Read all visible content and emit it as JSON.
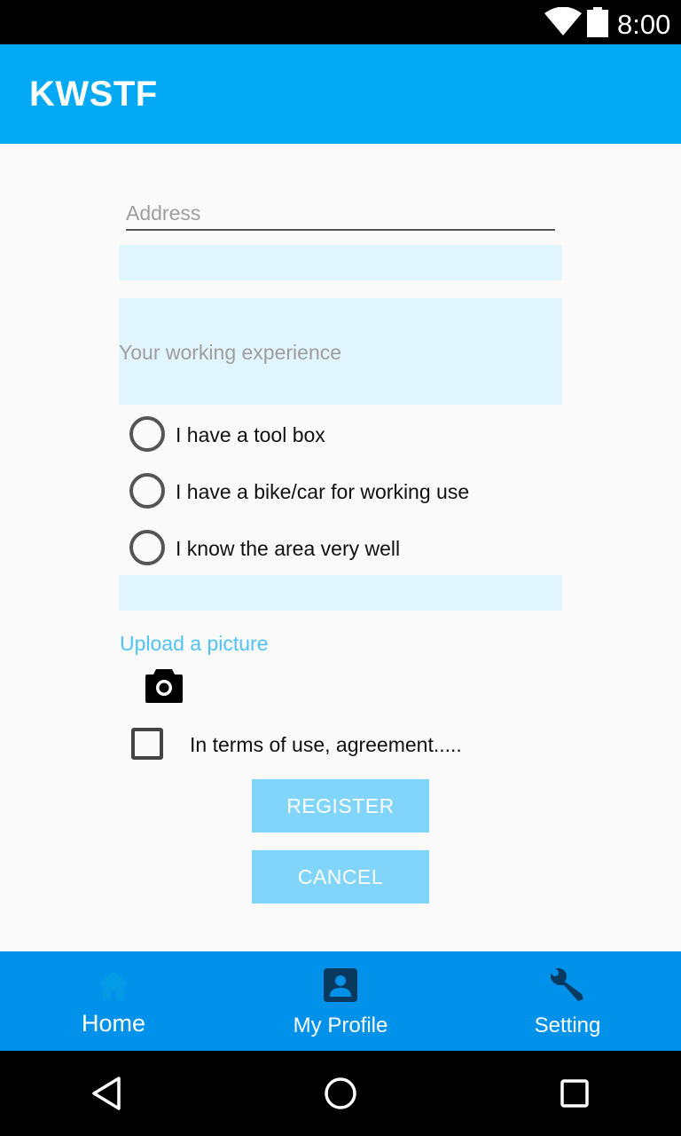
{
  "status_bar": {
    "time": "8:00",
    "icons": [
      "wifi-icon",
      "battery-icon"
    ]
  },
  "app_bar": {
    "title": "KWSTF"
  },
  "form": {
    "address_placeholder": "Address",
    "experience_placeholder": "Your working experience",
    "options": [
      {
        "label": "I have a tool box",
        "checked": false
      },
      {
        "label": "I have a bike/car for working use",
        "checked": false
      },
      {
        "label": "I know the area very well",
        "checked": false
      }
    ],
    "upload_label": "Upload a picture",
    "upload_icon": "camera-icon",
    "terms_label": "In terms of use, agreement.....",
    "terms_checked": false,
    "register_label": "REGISTER",
    "cancel_label": "CANCEL"
  },
  "bottom_nav": {
    "items": [
      {
        "label": "Home",
        "icon": "home-icon",
        "active": true
      },
      {
        "label": "My Profile",
        "icon": "account-box-icon",
        "active": false
      },
      {
        "label": "Setting",
        "icon": "wrench-icon",
        "active": false
      }
    ]
  },
  "colors": {
    "primary": "#03a9f4",
    "primary_dark": "#0091ea",
    "accent_light": "#e1f5fe",
    "button": "#81d4fa",
    "upload_text": "#4fc3f7",
    "nav_icon": "#073a5e"
  }
}
